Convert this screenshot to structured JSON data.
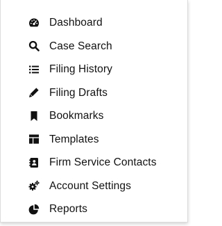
{
  "menu": {
    "items": [
      {
        "label": "Dashboard",
        "icon": "tachometer-icon"
      },
      {
        "label": "Case Search",
        "icon": "search-icon"
      },
      {
        "label": "Filing History",
        "icon": "list-icon"
      },
      {
        "label": "Filing Drafts",
        "icon": "pencil-icon"
      },
      {
        "label": "Bookmarks",
        "icon": "bookmark-icon"
      },
      {
        "label": "Templates",
        "icon": "template-icon"
      },
      {
        "label": "Firm Service Contacts",
        "icon": "contact-card-icon"
      },
      {
        "label": "Account Settings",
        "icon": "cogs-icon"
      },
      {
        "label": "Reports",
        "icon": "pie-chart-icon"
      }
    ]
  }
}
